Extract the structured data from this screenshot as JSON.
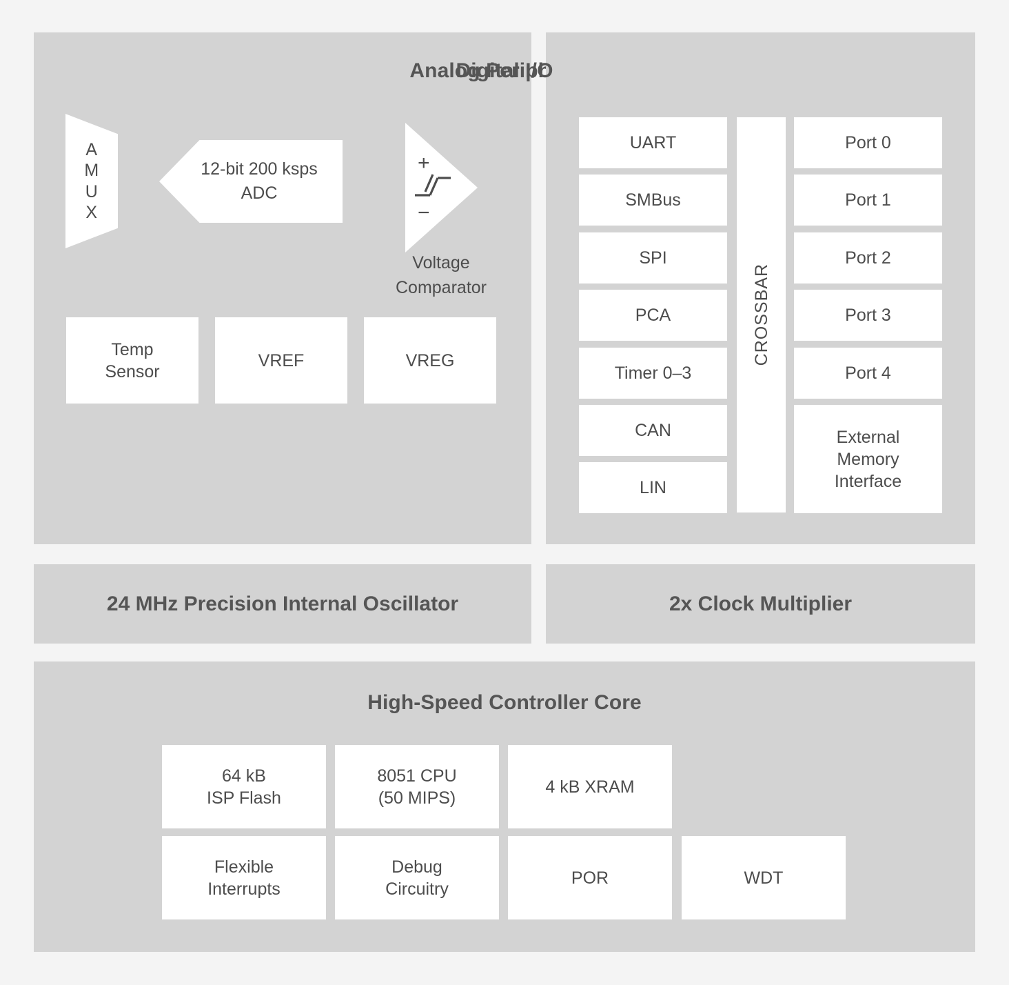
{
  "diagram": {
    "title": "Microcontroller Block Diagram",
    "colors": {
      "background": "#f4f4f4",
      "panel": "#d3d3d3",
      "block": "#ffffff",
      "title_text": "#555555",
      "block_text": "#4d4d4d"
    }
  },
  "analog": {
    "title": "Analog Peripherals",
    "amux": {
      "letters": [
        "A",
        "M",
        "U",
        "X"
      ],
      "icon": "trapezoid-mux-shape"
    },
    "adc": {
      "line1": "12-bit 200 ksps",
      "line2": "ADC",
      "icon": "left-pointing-pentagon-shape"
    },
    "comparator": {
      "plus": "+",
      "minus": "−",
      "icon": "hysteresis-symbol",
      "caption_line1": "Voltage",
      "caption_line2": "Comparator",
      "shape": "right-pointing-triangle"
    },
    "blocks": [
      {
        "id": "temp-sensor",
        "line1": "Temp",
        "line2": "Sensor"
      },
      {
        "id": "vref",
        "line1": "VREF",
        "line2": ""
      },
      {
        "id": "vreg",
        "line1": "VREG",
        "line2": ""
      }
    ]
  },
  "digital": {
    "title": "Digital I/O",
    "crossbar_label": "CROSSBAR",
    "peripherals": [
      {
        "label": "UART"
      },
      {
        "label": "SMBus"
      },
      {
        "label": "SPI"
      },
      {
        "label": "PCA"
      },
      {
        "label": "Timer 0–3"
      },
      {
        "label": "CAN"
      },
      {
        "label": "LIN"
      }
    ],
    "ports": [
      {
        "label": "Port 0"
      },
      {
        "label": "Port 1"
      },
      {
        "label": "Port 2"
      },
      {
        "label": "Port 3"
      },
      {
        "label": "Port 4"
      }
    ],
    "external_memory": {
      "line1": "External",
      "line2": "Memory",
      "line3": "Interface"
    }
  },
  "clocks": {
    "oscillator": "24 MHz Precision Internal Oscillator",
    "multiplier": "2x Clock Multiplier"
  },
  "core": {
    "title": "High-Speed Controller Core",
    "row1": [
      {
        "line1": "64 kB",
        "line2": "ISP Flash"
      },
      {
        "line1": "8051 CPU",
        "line2": "(50 MIPS)"
      },
      {
        "line1": "4 kB XRAM",
        "line2": ""
      }
    ],
    "row2": [
      {
        "line1": "Flexible",
        "line2": "Interrupts"
      },
      {
        "line1": "Debug",
        "line2": "Circuitry"
      },
      {
        "line1": "POR",
        "line2": ""
      },
      {
        "line1": "WDT",
        "line2": ""
      }
    ]
  }
}
